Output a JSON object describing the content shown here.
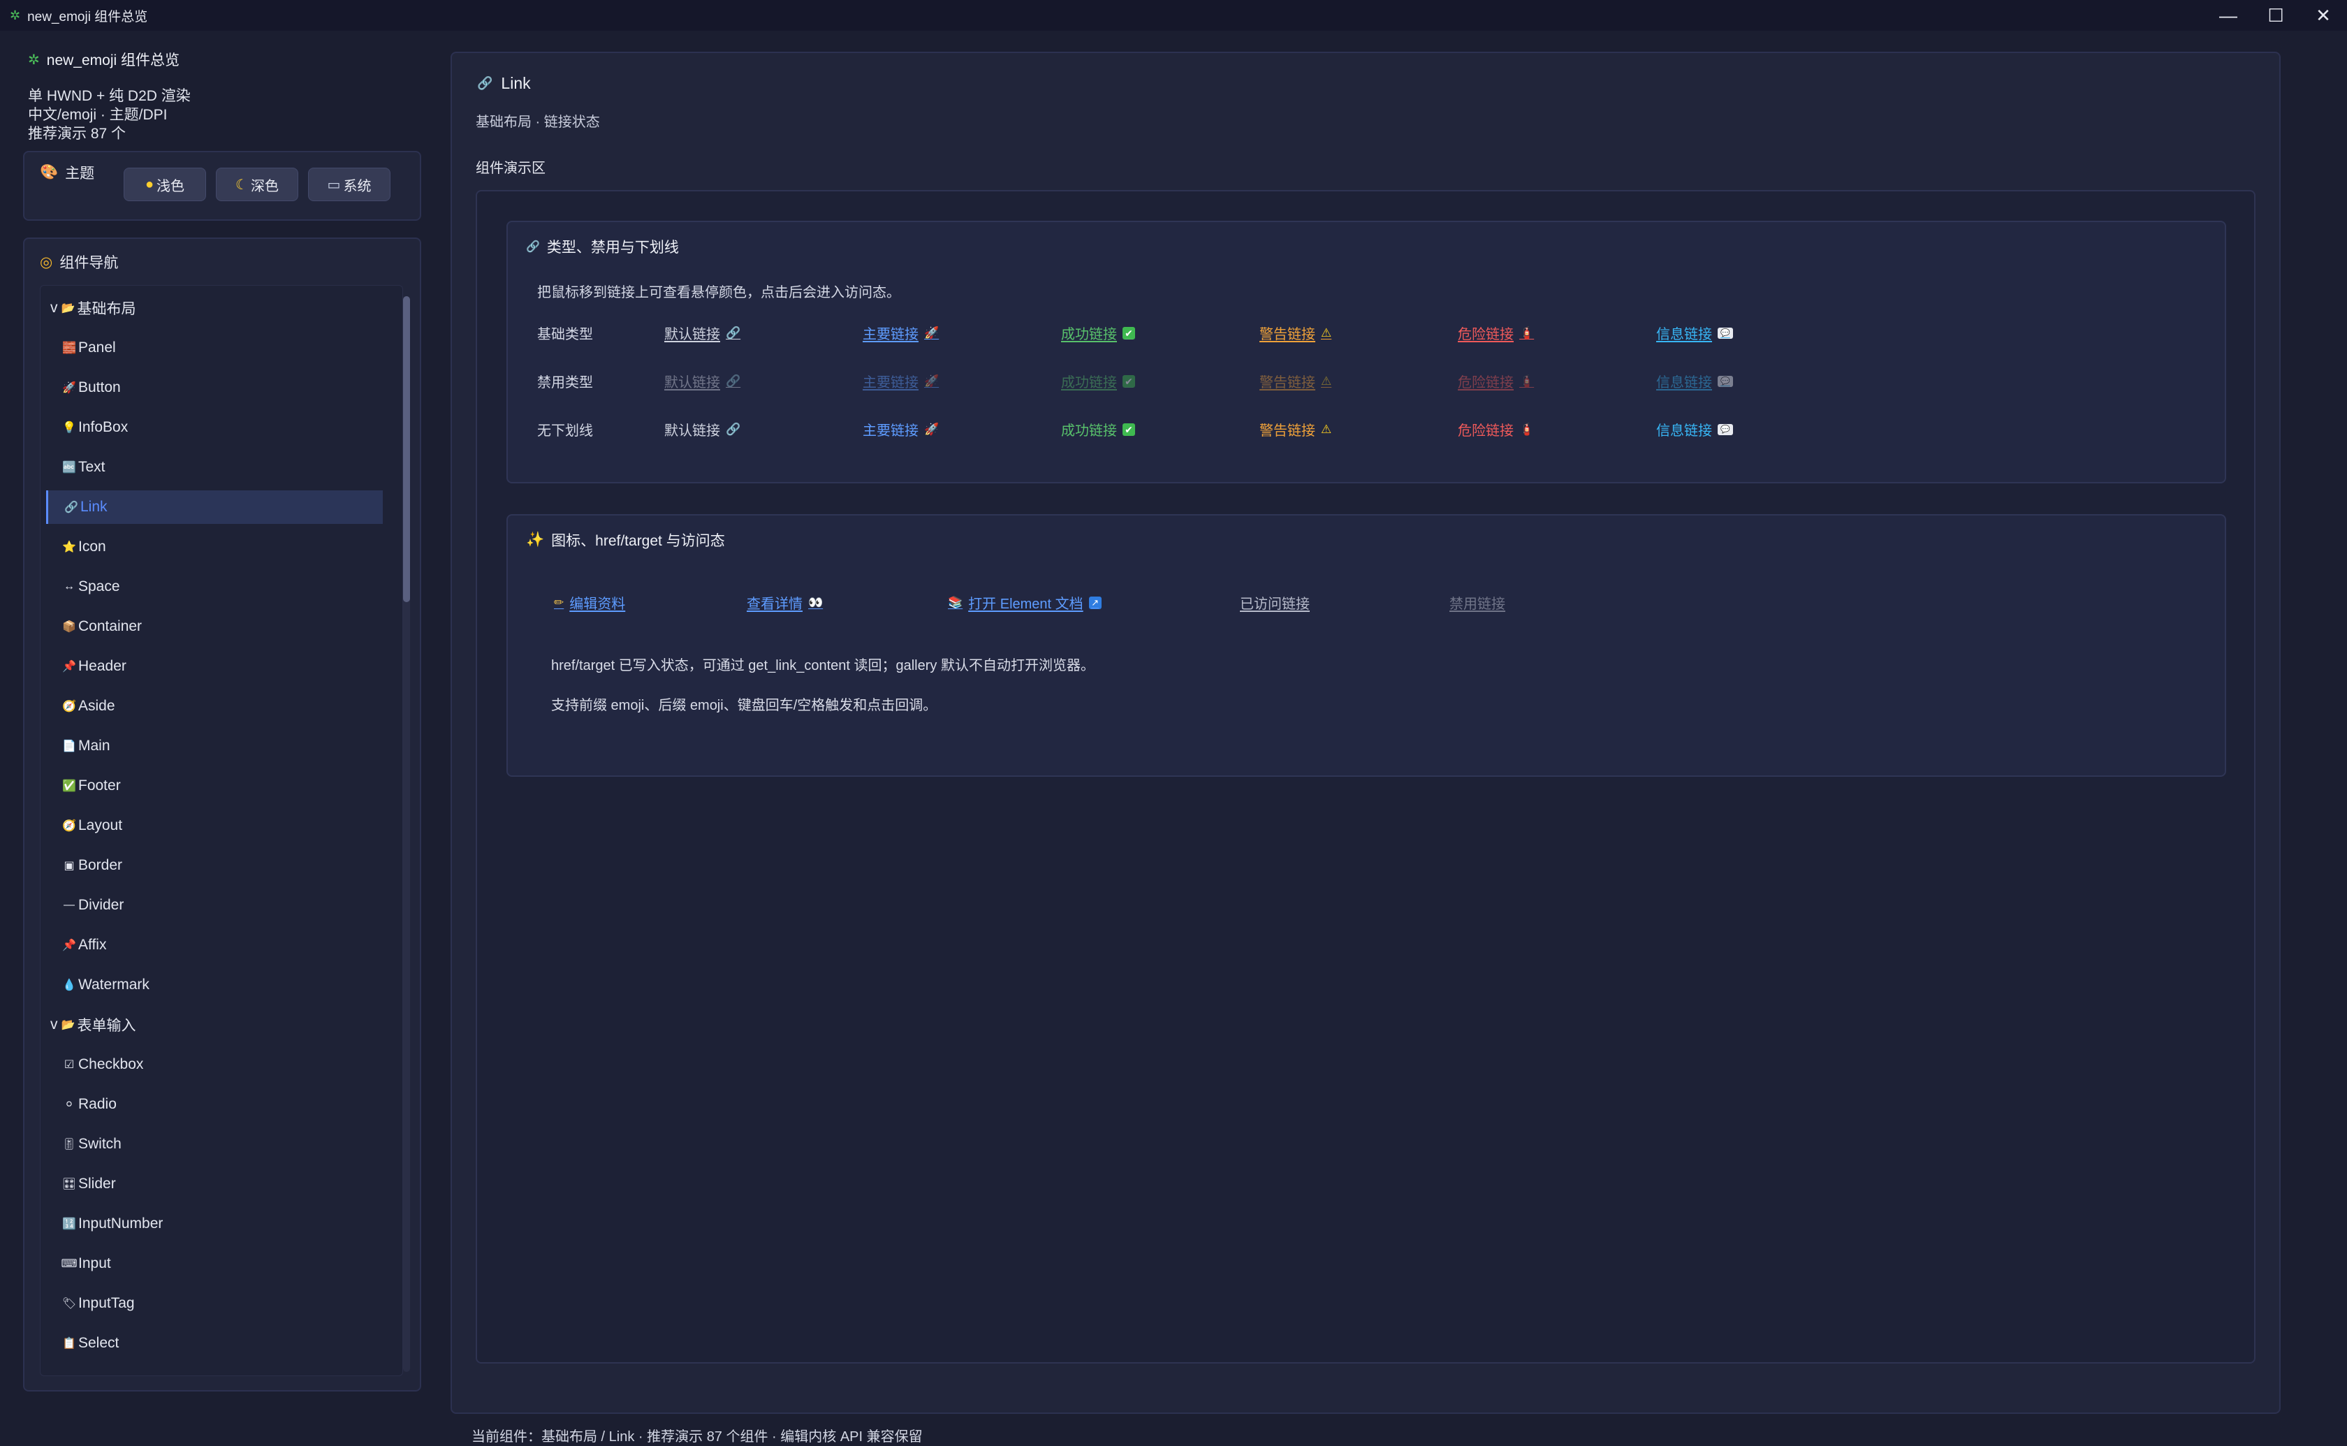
{
  "window": {
    "title": "new_emoji 组件总览",
    "controls": {
      "minimize": "—",
      "maximize": "☐",
      "close": "✕"
    }
  },
  "sidebar": {
    "app_name": "new_emoji 组件总览",
    "info_lines": [
      "单 HWND + 纯 D2D 渲染",
      "中文/emoji · 主题/DPI",
      "推荐演示 87 个"
    ],
    "theme": {
      "label": "主题",
      "buttons": [
        {
          "icon": "🟡",
          "label": "浅色"
        },
        {
          "icon": "🌙",
          "label": "深色"
        },
        {
          "icon": "💻",
          "label": "系统"
        }
      ]
    },
    "nav": {
      "label": "组件导航",
      "items": [
        {
          "label": "基础布局",
          "icon": "📂",
          "type": "group",
          "expander": "v"
        },
        {
          "label": "Panel",
          "icon": "🧱",
          "type": "child"
        },
        {
          "label": "Button",
          "icon": "🚀",
          "type": "child"
        },
        {
          "label": "InfoBox",
          "icon": "💡",
          "type": "child"
        },
        {
          "label": "Text",
          "icon": "🔤",
          "type": "child"
        },
        {
          "label": "Link",
          "icon": "🔗",
          "type": "child",
          "active": true
        },
        {
          "label": "Icon",
          "icon": "⭐",
          "type": "child"
        },
        {
          "label": "Space",
          "icon": "↔",
          "type": "child"
        },
        {
          "label": "Container",
          "icon": "📦",
          "type": "child"
        },
        {
          "label": "Header",
          "icon": "📌",
          "type": "child"
        },
        {
          "label": "Aside",
          "icon": "🧭",
          "type": "child"
        },
        {
          "label": "Main",
          "icon": "📄",
          "type": "child"
        },
        {
          "label": "Footer",
          "icon": "✅",
          "type": "child"
        },
        {
          "label": "Layout",
          "icon": "🧭",
          "type": "child"
        },
        {
          "label": "Border",
          "icon": "▣",
          "type": "child"
        },
        {
          "label": "Divider",
          "icon": "—",
          "type": "child"
        },
        {
          "label": "Affix",
          "icon": "📌",
          "type": "child"
        },
        {
          "label": "Watermark",
          "icon": "💧",
          "type": "child"
        },
        {
          "label": "表单输入",
          "icon": "📂",
          "type": "group",
          "expander": "v"
        },
        {
          "label": "Checkbox",
          "icon": "☑",
          "type": "child"
        },
        {
          "label": "Radio",
          "icon": "⚪",
          "type": "child"
        },
        {
          "label": "Switch",
          "icon": "🎚",
          "type": "child"
        },
        {
          "label": "Slider",
          "icon": "🎛",
          "type": "child"
        },
        {
          "label": "InputNumber",
          "icon": "🔢",
          "type": "child"
        },
        {
          "label": "Input",
          "icon": "⌨",
          "type": "child"
        },
        {
          "label": "InputTag",
          "icon": "🏷",
          "type": "child"
        },
        {
          "label": "Select",
          "icon": "📋",
          "type": "child"
        }
      ]
    }
  },
  "main": {
    "title": "Link",
    "title_icon": "🔗",
    "subtitle": "基础布局 · 链接状态",
    "demo_label": "组件演示区",
    "section1": {
      "title": "类型、禁用与下划线",
      "title_icon": "🔗",
      "desc": "把鼠标移到链接上可查看悬停颜色，点击后会进入访问态。",
      "rows": [
        {
          "label": "基础类型",
          "links": [
            "默认链接",
            "主要链接",
            "成功链接",
            "警告链接",
            "危险链接",
            "信息链接"
          ]
        },
        {
          "label": "禁用类型",
          "links": [
            "默认链接",
            "主要链接",
            "成功链接",
            "警告链接",
            "危险链接",
            "信息链接"
          ]
        },
        {
          "label": "无下划线",
          "links": [
            "默认链接",
            "主要链接",
            "成功链接",
            "警告链接",
            "危险链接",
            "信息链接"
          ]
        }
      ],
      "link_emojis": [
        "🔗",
        "🚀",
        "✔",
        "⚠",
        "🧯",
        "💬"
      ]
    },
    "section2": {
      "title": "图标、href/target 与访问态",
      "title_icon": "✨",
      "links": [
        {
          "prefix": "✏",
          "label": "编辑资料",
          "suffix": ""
        },
        {
          "prefix": "",
          "label": "查看详情",
          "suffix": "👀"
        },
        {
          "prefix": "📚",
          "label": "打开 Element 文档",
          "suffix": "↗"
        },
        {
          "prefix": "",
          "label": "已访问链接",
          "suffix": ""
        },
        {
          "prefix": "",
          "label": "禁用链接",
          "suffix": ""
        }
      ],
      "notes": [
        "href/target 已写入状态，可通过 get_link_content 读回；gallery 默认不自动打开浏览器。",
        "支持前缀 emoji、后缀 emoji、键盘回车/空格触发和点击回调。"
      ]
    }
  },
  "status_bar": "当前组件：基础布局 / Link · 推荐演示 87 个组件 · 编辑内核 API 兼容保留",
  "colors": {
    "background": "#1b1e30",
    "panel": "#21253a",
    "accent": "#5b8cff",
    "primary": "#5e9cff",
    "success": "#58c16b",
    "warning": "#f0a239",
    "danger": "#f05a5a",
    "info": "#38b6f5"
  }
}
